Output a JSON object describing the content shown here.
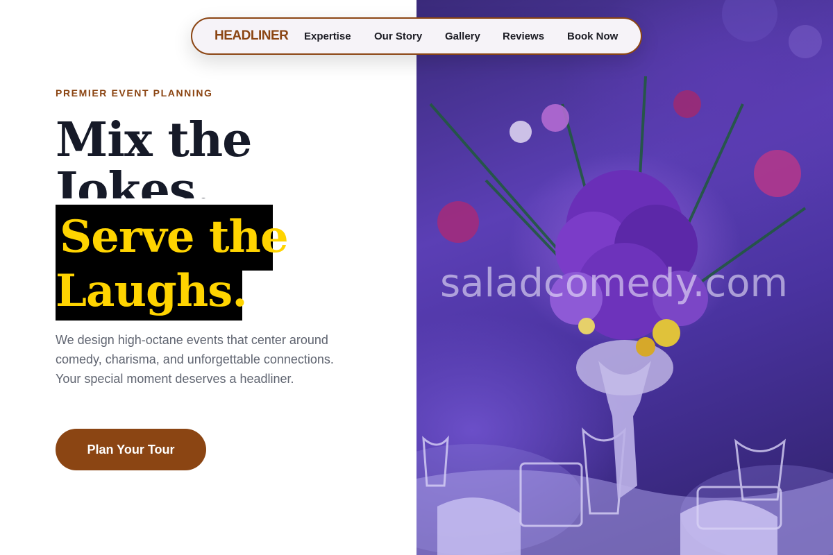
{
  "nav": {
    "logo": "HEADLINER",
    "links": [
      "Expertise",
      "Our Story",
      "Gallery",
      "Reviews",
      "Book Now"
    ]
  },
  "hero": {
    "eyebrow": "PREMIER EVENT PLANNING",
    "headline_line1": "Mix the",
    "headline_line2": "Jokes.",
    "highlight_line1": "Serve the",
    "highlight_line2": "Laughs.",
    "description": "We design high-octane events that center around comedy, charisma, and unforgettable connections. Your special moment deserves a headliner.",
    "cta_label": "Plan Your Tour"
  },
  "photo": {
    "watermark": "saladcomedy.com",
    "icon": "floral-centerpiece-image"
  },
  "colors": {
    "brand_brown": "#8b4513",
    "headline_dark": "#161a28",
    "highlight_yellow": "#ffd400",
    "highlight_bg": "#000000",
    "photo_purple": "#5b3fb5"
  }
}
